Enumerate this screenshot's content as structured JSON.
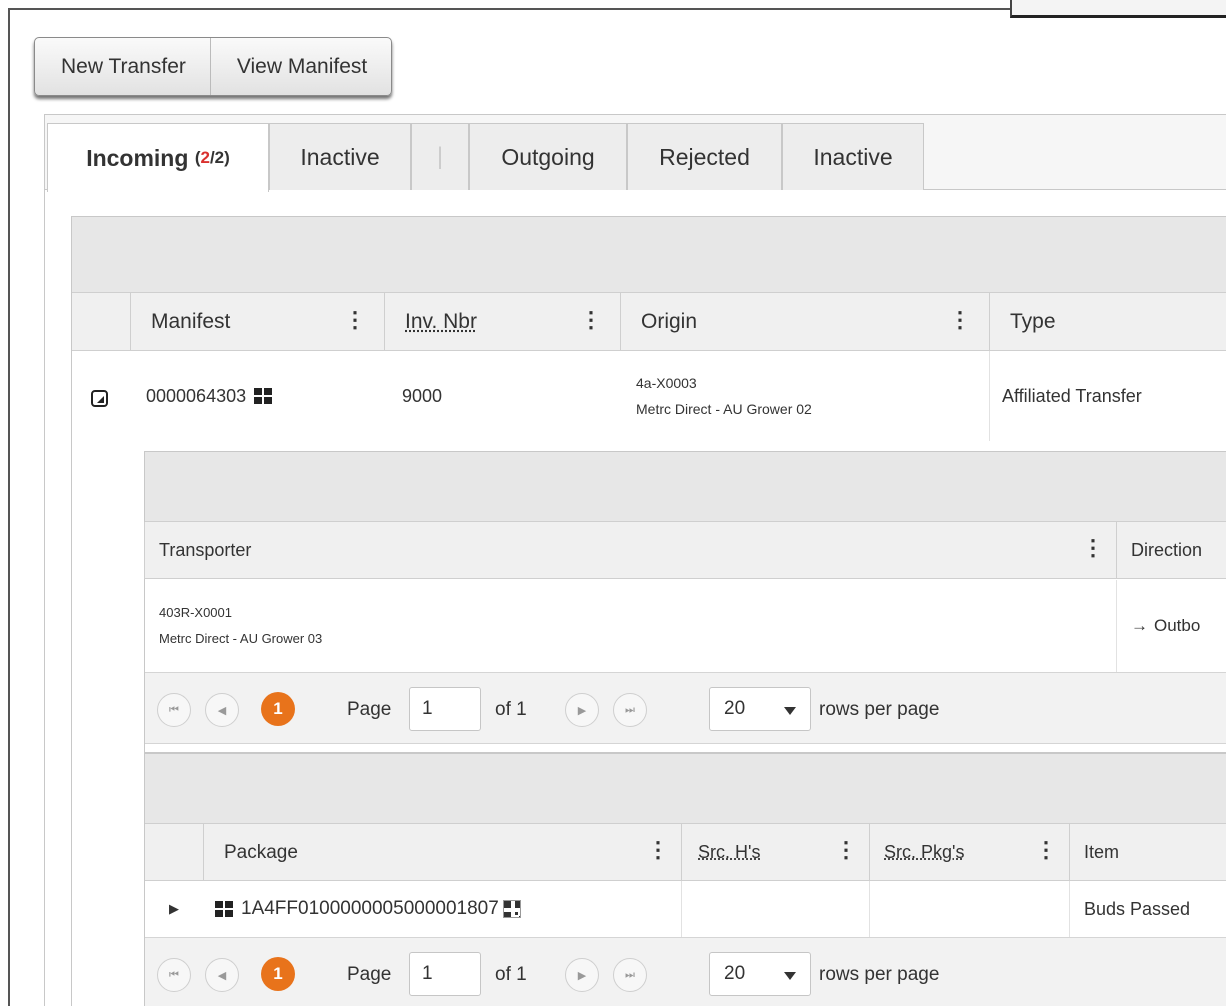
{
  "toolbar": {
    "new_transfer_label": "New Transfer",
    "view_manifest_label": "View Manifest"
  },
  "tabs": [
    {
      "label": "Incoming",
      "count_open": "(",
      "count_num": "2",
      "count_sep": "/2)",
      "active": true
    },
    {
      "label": "Inactive"
    },
    {
      "label": "|"
    },
    {
      "label": "Outgoing"
    },
    {
      "label": "Rejected"
    },
    {
      "label": "Inactive"
    }
  ],
  "transfers_grid": {
    "columns": [
      {
        "label": "Manifest"
      },
      {
        "label": "Inv. Nbr"
      },
      {
        "label": "Origin"
      },
      {
        "label": "Type"
      }
    ],
    "rows": [
      {
        "manifest": "0000064303",
        "inv_nbr": "9000",
        "origin_license": "4a-X0003",
        "origin_name": "Metrc Direct - AU Grower 02",
        "type": "Affiliated Transfer"
      }
    ]
  },
  "transporter_grid": {
    "columns": [
      {
        "label": "Transporter"
      },
      {
        "label": "Direction"
      }
    ],
    "rows": [
      {
        "license": "403R-X0001",
        "name": "Metrc Direct - AU Grower 03",
        "direction": "Outbo"
      }
    ],
    "pager": {
      "current": "1",
      "page_label": "Page",
      "page_value": "1",
      "of_label": "of 1",
      "rows_value": "20",
      "rows_label": "rows per page"
    }
  },
  "packages_grid": {
    "columns": [
      {
        "label": "Package"
      },
      {
        "label": "Src. H's"
      },
      {
        "label": "Src. Pkg's"
      },
      {
        "label": "Item"
      }
    ],
    "rows": [
      {
        "package": "1A4FF0100000005000001807",
        "src_h": "",
        "src_pkg": "",
        "item": "Buds Passed"
      }
    ],
    "pager": {
      "current": "1",
      "page_label": "Page",
      "page_value": "1",
      "of_label": "of 1",
      "rows_value": "20",
      "rows_label": "rows per page"
    }
  },
  "icons": {
    "expand": "expand-collapse-icon",
    "manifest_grid": "grid-icon",
    "package_grid": "grid-icon",
    "qr": "qr-code-icon",
    "arrow": "arrow-right-icon",
    "row_expand": "triangle-right-icon"
  },
  "colors": {
    "accent_orange": "#e8731b",
    "count_red": "#d9312e"
  }
}
